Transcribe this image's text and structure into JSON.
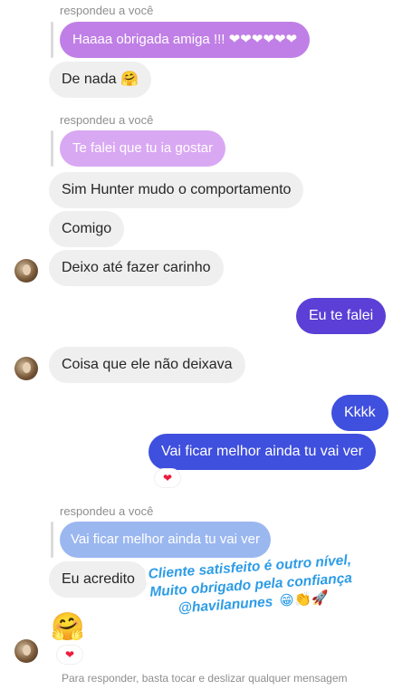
{
  "messages": {
    "reply_label": "respondeu a você",
    "m1_reply": "Haaaa obrigada amiga !!! ❤❤❤❤❤❤",
    "m2": "De nada 🤗",
    "m3_reply": "Te falei que tu ia gostar",
    "m4": "Sim Hunter mudo o comportamento",
    "m5": "Comigo",
    "m6": "Deixo até fazer carinho",
    "m7_sent": "Eu te falei",
    "m8": "Coisa que ele não deixava",
    "m9_sent": "Kkkk",
    "m10_sent": "Vai ficar melhor ainda tu vai ver",
    "m11_reply": "Vai ficar melhor ainda tu vai ver",
    "m12": "Eu acredito",
    "m13_emoji": "🤗",
    "reaction": "❤"
  },
  "sticker": {
    "line1": "Cliente satisfeito é outro nível,",
    "line2": "Muito obrigado pela confiança",
    "line3": "@havilanunes",
    "emojis": "😁👏🚀"
  },
  "footer": {
    "hint": "Para responder, basta tocar e deslizar qualquer mensagem"
  },
  "colors": {
    "received_bubble": "#efefef",
    "sent_bubble": "#5b3fd6",
    "reply_bubble": "#c07fe6",
    "sticker_text": "#2d9ce6",
    "reaction_heart": "#ed1c3c"
  }
}
